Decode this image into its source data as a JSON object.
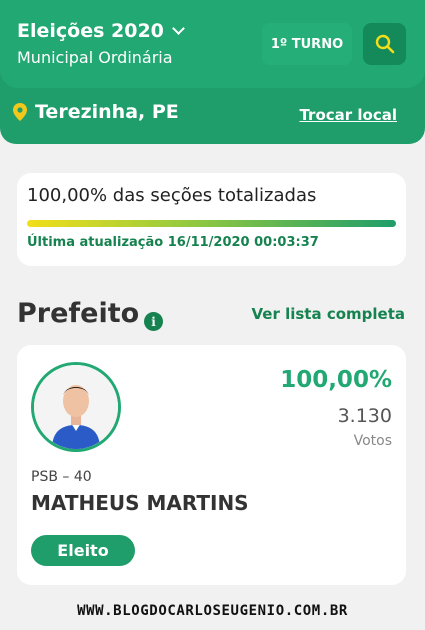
{
  "header": {
    "title": "Eleições 2020",
    "subtitle": "Municipal Ordinária",
    "turno_label": "1º TURNO",
    "search_icon": "search-icon",
    "location_icon": "location-pin-icon",
    "location": "Terezinha, PE",
    "change_location_label": "Trocar local"
  },
  "status": {
    "sections_text": "100,00% das seções totalizadas",
    "progress_fraction": 1.0,
    "last_update": "Última atualização 16/11/2020 00:03:37"
  },
  "section": {
    "title": "Prefeito",
    "info_icon": "info-icon",
    "full_list_label": "Ver lista completa"
  },
  "candidate": {
    "percent": "100,00%",
    "votes": "3.130",
    "votes_label": "Votos",
    "party": "PSB – 40",
    "name": "MATHEUS MARTINS",
    "status_badge": "Eleito"
  },
  "watermark": "WWW.BLOGDOCARLOSEUGENIO.COM.BR",
  "colors": {
    "brand_green": "#22a873",
    "dark_green": "#16824f",
    "search_accent": "#f2de1a"
  }
}
